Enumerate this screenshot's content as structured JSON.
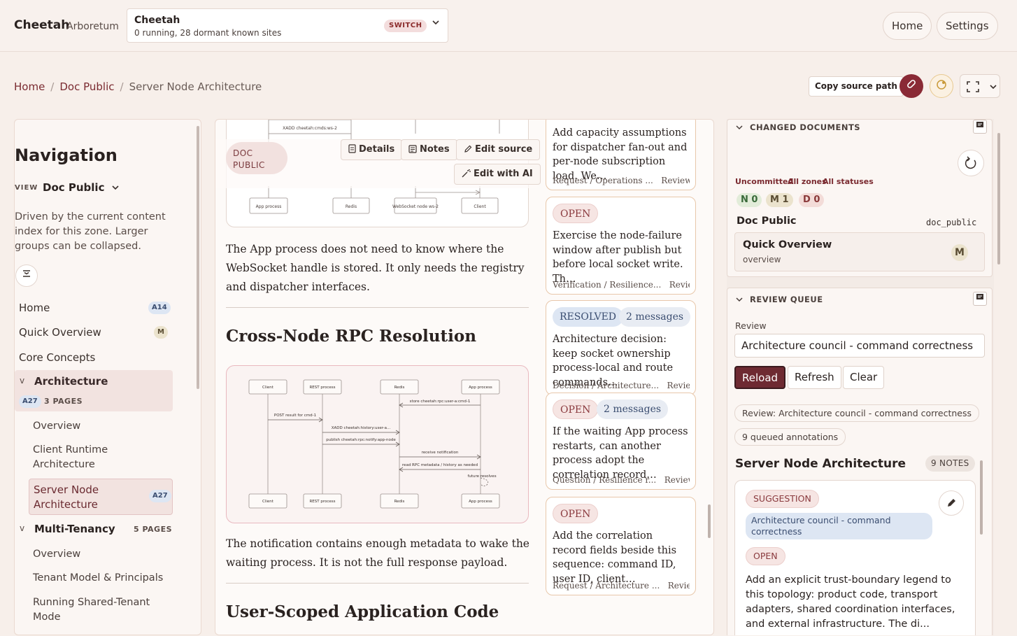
{
  "header": {
    "brand": "Cheetah",
    "brand_sub": "Arboretum",
    "site_name": "Cheetah",
    "site_status": "0 running, 28 dormant known sites",
    "switch_label": "SWITCH",
    "nav_home": "Home",
    "nav_settings": "Settings"
  },
  "breadcrumb": {
    "items": [
      "Home",
      "Doc Public",
      "Server Node Architecture"
    ],
    "separator": "/"
  },
  "toolbar": {
    "copy_source": "Copy source path"
  },
  "nav": {
    "title": "Navigation",
    "view_label": "VIEW",
    "view_value": "Doc Public",
    "description": "Driven by the current content index for this zone. Larger groups can be collapsed.",
    "items": [
      {
        "label": "Home",
        "badge": "A14"
      },
      {
        "label": "Quick Overview",
        "badge": "M"
      },
      {
        "label": "Core Concepts"
      }
    ],
    "groups": [
      {
        "label": "Architecture",
        "badge": "A27",
        "count": "3 PAGES",
        "children": [
          "Overview",
          "Client Runtime Architecture",
          "Server Node Architecture"
        ],
        "active_badge": "A27"
      },
      {
        "label": "Multi-Tenancy",
        "count": "5 PAGES",
        "children": [
          "Overview",
          "Tenant Model & Principals",
          "Running Shared-Tenant Mode"
        ]
      }
    ],
    "collapse_marker": "v"
  },
  "doc": {
    "badge": "DOC PUBLIC",
    "buttons": {
      "details": "Details",
      "notes": "Notes",
      "edit_source": "Edit source",
      "edit_ai": "Edit with AI"
    },
    "para1": "The App process does not need to know where the WebSocket handle is stored. It only needs the registry and dispatcher interfaces.",
    "heading1": "Cross-Node RPC Resolution",
    "para2": "The notification contains enough metadata to wake the waiting process. It is not the full response payload.",
    "heading2": "User-Scoped Application Code",
    "fig1_labels": [
      "XADD cheetah:cmds:ws-2",
      "App process",
      "Redis",
      "WebSocket node ws-2",
      "Client"
    ],
    "fig2_lanes": [
      "Client",
      "REST process",
      "Redis",
      "App process"
    ],
    "fig2_messages": [
      "store cheetah:rpc:user-a:cmd-1",
      "POST result for cmd-1",
      "XADD cheetah:history:user-a...",
      "publish cheetah:rpc:notify:app-node",
      "receive notification",
      "read RPC metadata / history as needed",
      "future resolves"
    ]
  },
  "annotations": [
    {
      "text": "Add capacity assumptions for dispatcher fan-out and per-node subscription load. We…",
      "footer": "Request / Operations ...",
      "review": "Review ..."
    },
    {
      "status": "OPEN",
      "text": "Exercise the node-failure window after publish but before local socket write. Th…",
      "footer": "Verification / Resilience...",
      "review": "Review..."
    },
    {
      "status": "RESOLVED",
      "messages": "2 messages",
      "text": "Architecture decision: keep socket ownership process-local and route commands…",
      "footer": "Decision / Architecture...",
      "review": "Review ..."
    },
    {
      "status": "OPEN",
      "messages": "2 messages",
      "text": "If the waiting App process restarts, can another process adopt the correlation record…",
      "footer": "Question / Resilience r...",
      "review": "Review ..."
    },
    {
      "status": "OPEN",
      "text": "Add the correlation record fields beside this sequence: command ID, user ID, client…",
      "footer": "Request / Architecture ...",
      "review": "Review ..."
    }
  ],
  "changed_docs": {
    "heading": "CHANGED DOCUMENTS",
    "filters": [
      "Uncommitted",
      "All zones",
      "All statuses"
    ],
    "counts": [
      {
        "label": "N 0",
        "color": "#3a6a3a",
        "bg": "#e2ecd9"
      },
      {
        "label": "M 1",
        "color": "#5a4d33",
        "bg": "#ebe3cd"
      },
      {
        "label": "D 0",
        "color": "#8a3a3a",
        "bg": "#f3dcd8"
      }
    ],
    "zone_title": "Doc Public",
    "zone_id": "doc_public",
    "doc_title": "Quick Overview",
    "doc_sub": "overview",
    "doc_mark": "M"
  },
  "review_queue": {
    "heading": "REVIEW QUEUE",
    "review_label": "Review",
    "review_value": "Architecture council - command correctness",
    "buttons": {
      "reload": "Reload",
      "refresh": "Refresh",
      "clear": "Clear"
    },
    "review_chip": "Review: Architecture council - command correctness",
    "queued_chip": "9 queued annotations",
    "doc_title": "Server Node Architecture",
    "notes_count": "9 NOTES",
    "note": {
      "type": "SUGGESTION",
      "review": "Architecture council - command correctness",
      "status": "OPEN",
      "text": "Add an explicit trust-boundary legend to this topology: product code, transport adapters, shared coordination interfaces, and external infrastructure. The di..."
    }
  },
  "colors": {
    "accent": "#7a2a30",
    "reload_bg": "#6e2a32",
    "avatar_bg": "#8a2a36",
    "page_bg": "#f7efea"
  }
}
